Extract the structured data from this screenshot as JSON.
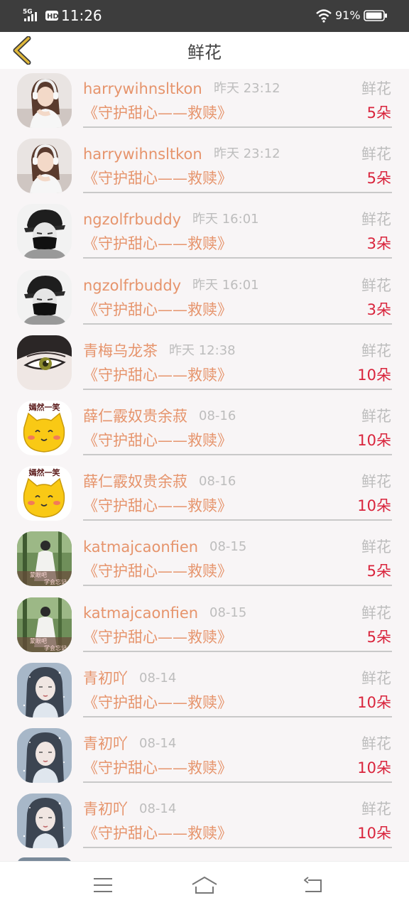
{
  "status_bar": {
    "network": "5G",
    "hd": "HD",
    "time": "11:26",
    "battery": "91%"
  },
  "header": {
    "title": "鲜花",
    "back_icon": "chevron-left-icon"
  },
  "colors": {
    "accent_orange": "#e6946c",
    "quantity_red": "#d9243c",
    "muted_gray": "#bdbdbd",
    "back_icon": "#d4a72c"
  },
  "gifts": [
    {
      "user": "harrywihnsltkon",
      "time": "昨天 23:12",
      "gift": "鲜花",
      "book": "《守护甜心——救赎》",
      "qty": "5朵",
      "avatar": "headphone-girl"
    },
    {
      "user": "harrywihnsltkon",
      "time": "昨天 23:12",
      "gift": "鲜花",
      "book": "《守护甜心——救赎》",
      "qty": "5朵",
      "avatar": "headphone-girl"
    },
    {
      "user": "ngzolfrbuddy",
      "time": "昨天 16:01",
      "gift": "鲜花",
      "book": "《守护甜心——救赎》",
      "qty": "3朵",
      "avatar": "masked-boy"
    },
    {
      "user": "ngzolfrbuddy",
      "time": "昨天 16:01",
      "gift": "鲜花",
      "book": "《守护甜心——救赎》",
      "qty": "3朵",
      "avatar": "masked-boy"
    },
    {
      "user": "青梅乌龙茶",
      "time": "昨天 12:38",
      "gift": "鲜花",
      "book": "《守护甜心——救赎》",
      "qty": "10朵",
      "avatar": "anime-eye"
    },
    {
      "user": "薛仁霰奴贵余菽",
      "time": "08-16",
      "gift": "鲜花",
      "book": "《守护甜心——救赎》",
      "qty": "10朵",
      "avatar": "yellow-cat"
    },
    {
      "user": "薛仁霰奴贵余菽",
      "time": "08-16",
      "gift": "鲜花",
      "book": "《守护甜心——救赎》",
      "qty": "10朵",
      "avatar": "yellow-cat"
    },
    {
      "user": "katmajcaonfien",
      "time": "08-15",
      "gift": "鲜花",
      "book": "《守护甜心——救赎》",
      "qty": "5朵",
      "avatar": "forest-girl"
    },
    {
      "user": "katmajcaonfien",
      "time": "08-15",
      "gift": "鲜花",
      "book": "《守护甜心——救赎》",
      "qty": "5朵",
      "avatar": "forest-girl"
    },
    {
      "user": "青初吖",
      "time": "08-14",
      "gift": "鲜花",
      "book": "《守护甜心——救赎》",
      "qty": "10朵",
      "avatar": "painted-girl"
    },
    {
      "user": "青初吖",
      "time": "08-14",
      "gift": "鲜花",
      "book": "《守护甜心——救赎》",
      "qty": "10朵",
      "avatar": "painted-girl"
    },
    {
      "user": "青初吖",
      "time": "08-14",
      "gift": "鲜花",
      "book": "《守护甜心——救赎》",
      "qty": "10朵",
      "avatar": "painted-girl"
    }
  ],
  "avatar_text": {
    "cat_caption": "嫣然一笑",
    "forest_caption_1": "蒙眼吧",
    "forest_caption_2": "学会忘记"
  },
  "nav_bar": {
    "menu_icon": "menu-icon",
    "home_icon": "home-icon",
    "back_icon": "return-icon"
  }
}
